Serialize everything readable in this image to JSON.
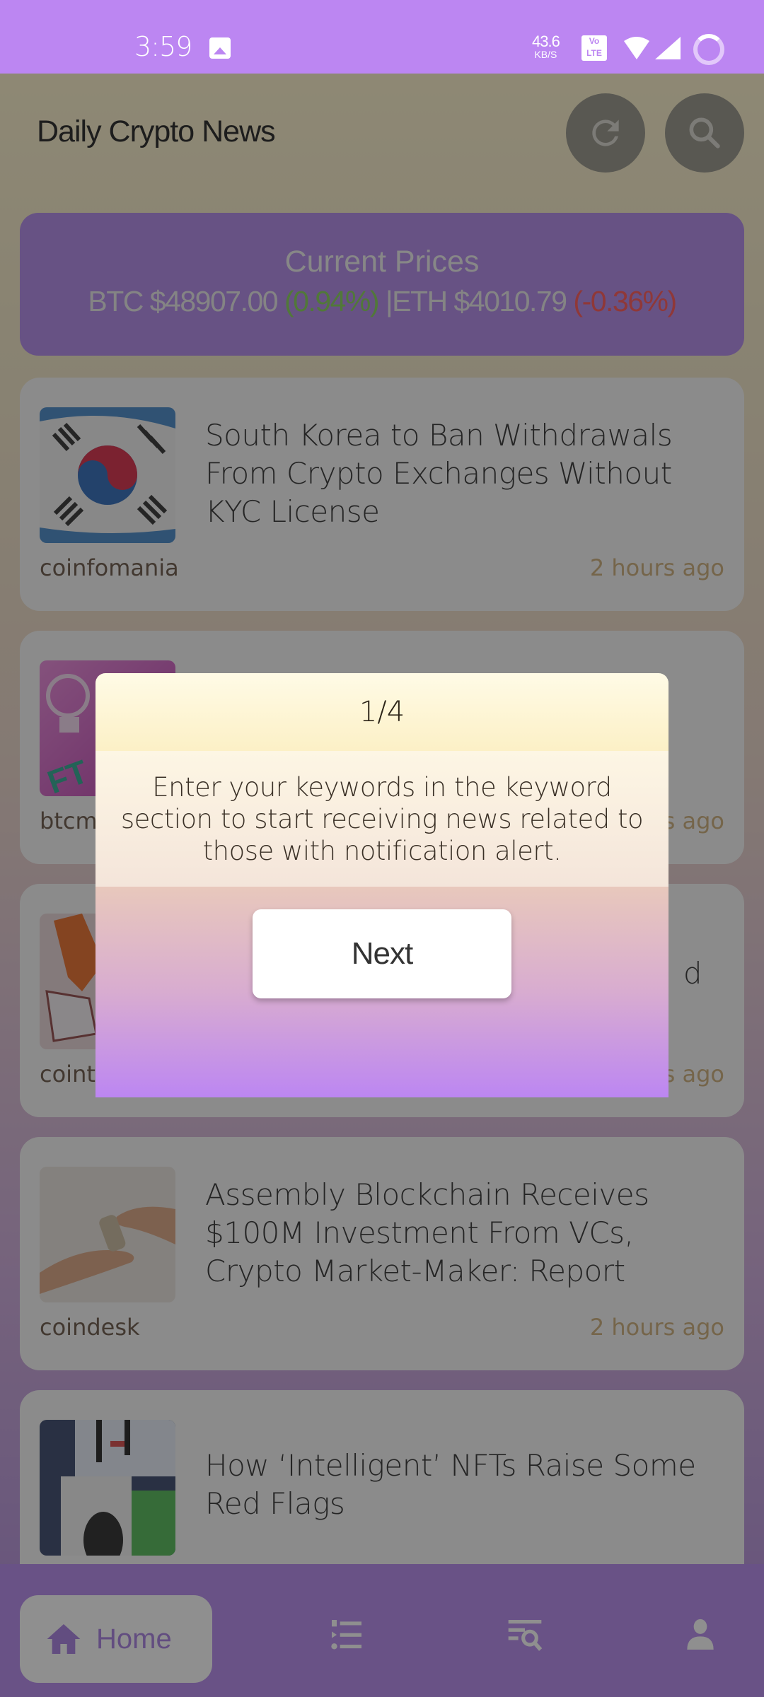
{
  "status_bar": {
    "time": "3:59",
    "net_speed_value": "43.6",
    "net_speed_unit": "KB/S",
    "volte_label": "Vo LTE"
  },
  "header": {
    "title": "Daily Crypto News",
    "refresh_icon": "refresh-icon",
    "search_icon": "search-icon"
  },
  "prices": {
    "title": "Current Prices",
    "btc_label": "BTC",
    "btc_price": "$48907.00",
    "btc_change": "(0.94%)",
    "separator": "|",
    "eth_label": "ETH",
    "eth_price": "$4010.79",
    "eth_change": "(-0.36%)",
    "positive_color": "#7ed04d",
    "negative_color": "#ff4a4a"
  },
  "news": [
    {
      "headline": "South Korea to Ban Withdrawals From Crypto Exchanges Without KYC License",
      "source": "coinfomania",
      "time": "2 hours ago",
      "thumb": "south-korea-flag"
    },
    {
      "headline": "",
      "source": "btcm",
      "time": "s ago",
      "thumb": "nft-lightbulb"
    },
    {
      "headline": "d",
      "source": "coint",
      "time": "s ago",
      "thumb": "crystals"
    },
    {
      "headline": "Assembly Blockchain Receives $100M Investment From VCs, Crypto Market-Maker: Report",
      "source": "coindesk",
      "time": "2 hours ago",
      "thumb": "hands-money"
    },
    {
      "headline": "How ‘Intelligent’ NFTs Raise Some Red Flags",
      "source": "",
      "time": "",
      "thumb": "nft-billboard"
    }
  ],
  "dialog": {
    "step": "1/4",
    "message": "Enter your keywords in the keyword section to start receiving news related to those with notification alert.",
    "next_label": "Next"
  },
  "bottom_nav": {
    "home_label": "Home",
    "items": [
      "home",
      "list",
      "search-news",
      "profile"
    ]
  },
  "colors": {
    "accent": "#bc86f2",
    "price_card": "#ac80e8"
  }
}
